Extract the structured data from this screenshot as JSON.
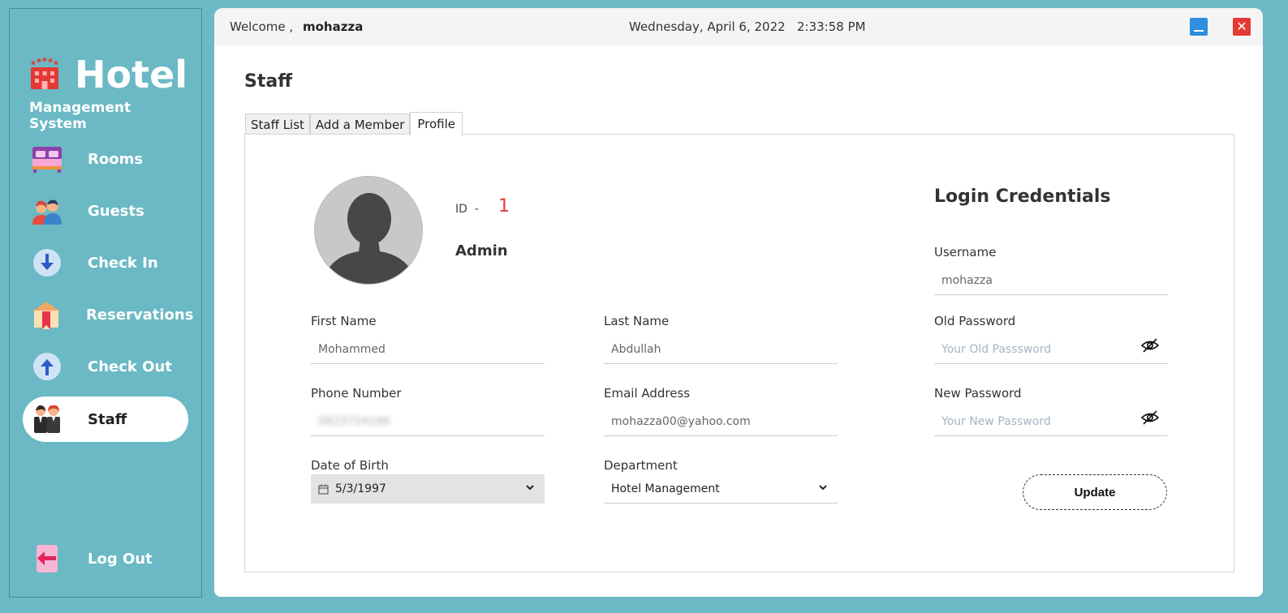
{
  "app": {
    "logo_title": "Hotel",
    "logo_subtitle": "Management System"
  },
  "sidebar": {
    "items": [
      {
        "label": "Rooms",
        "icon": "bed-icon",
        "active": false
      },
      {
        "label": "Guests",
        "icon": "guests-icon",
        "active": false
      },
      {
        "label": "Check In",
        "icon": "arrow-down-icon",
        "active": false
      },
      {
        "label": "Reservations",
        "icon": "reservation-icon",
        "active": false
      },
      {
        "label": "Check Out",
        "icon": "arrow-up-icon",
        "active": false
      },
      {
        "label": "Staff",
        "icon": "staff-icon",
        "active": true
      }
    ],
    "logout_label": "Log Out"
  },
  "topbar": {
    "welcome": "Welcome ,",
    "username": "mohazza",
    "datetime": "Wednesday, April 6, 2022   2:33:58 PM"
  },
  "page": {
    "title": "Staff",
    "tabs": [
      "Staff List",
      "Add a Member",
      "Profile"
    ],
    "active_tab": "Profile"
  },
  "profile": {
    "id_label": "ID  -",
    "id_value": "1",
    "role": "Admin",
    "first_name_label": "First Name",
    "first_name": "Mohammed",
    "last_name_label": "Last Name",
    "last_name": "Abdullah",
    "phone_label": "Phone Number",
    "phone": "0923724166",
    "email_label": "Email Address",
    "email": "mohazza00@yahoo.com",
    "dob_label": "Date of Birth",
    "dob": "5/3/1997",
    "department_label": "Department",
    "department": "Hotel Management"
  },
  "credentials": {
    "title": "Login Credentials",
    "username_label": "Username",
    "username": "mohazza",
    "old_password_label": "Old Password",
    "old_password_placeholder": "Your Old Passsword",
    "new_password_label": "New Password",
    "new_password_placeholder": "Your New Password",
    "update_label": "Update"
  },
  "colors": {
    "sidebar_bg": "#6ab9c4",
    "accent_red": "#e53935",
    "minimize_blue": "#2e8ee0"
  }
}
